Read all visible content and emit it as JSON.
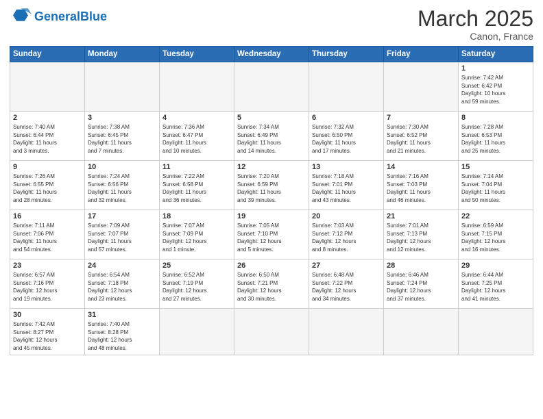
{
  "header": {
    "logo_general": "General",
    "logo_blue": "Blue",
    "month_title": "March 2025",
    "location": "Canon, France"
  },
  "weekdays": [
    "Sunday",
    "Monday",
    "Tuesday",
    "Wednesday",
    "Thursday",
    "Friday",
    "Saturday"
  ],
  "weeks": [
    [
      {
        "day": "",
        "info": ""
      },
      {
        "day": "",
        "info": ""
      },
      {
        "day": "",
        "info": ""
      },
      {
        "day": "",
        "info": ""
      },
      {
        "day": "",
        "info": ""
      },
      {
        "day": "",
        "info": ""
      },
      {
        "day": "1",
        "info": "Sunrise: 7:42 AM\nSunset: 6:42 PM\nDaylight: 10 hours\nand 59 minutes."
      }
    ],
    [
      {
        "day": "2",
        "info": "Sunrise: 7:40 AM\nSunset: 6:44 PM\nDaylight: 11 hours\nand 3 minutes."
      },
      {
        "day": "3",
        "info": "Sunrise: 7:38 AM\nSunset: 6:45 PM\nDaylight: 11 hours\nand 7 minutes."
      },
      {
        "day": "4",
        "info": "Sunrise: 7:36 AM\nSunset: 6:47 PM\nDaylight: 11 hours\nand 10 minutes."
      },
      {
        "day": "5",
        "info": "Sunrise: 7:34 AM\nSunset: 6:49 PM\nDaylight: 11 hours\nand 14 minutes."
      },
      {
        "day": "6",
        "info": "Sunrise: 7:32 AM\nSunset: 6:50 PM\nDaylight: 11 hours\nand 17 minutes."
      },
      {
        "day": "7",
        "info": "Sunrise: 7:30 AM\nSunset: 6:52 PM\nDaylight: 11 hours\nand 21 minutes."
      },
      {
        "day": "8",
        "info": "Sunrise: 7:28 AM\nSunset: 6:53 PM\nDaylight: 11 hours\nand 25 minutes."
      }
    ],
    [
      {
        "day": "9",
        "info": "Sunrise: 7:26 AM\nSunset: 6:55 PM\nDaylight: 11 hours\nand 28 minutes."
      },
      {
        "day": "10",
        "info": "Sunrise: 7:24 AM\nSunset: 6:56 PM\nDaylight: 11 hours\nand 32 minutes."
      },
      {
        "day": "11",
        "info": "Sunrise: 7:22 AM\nSunset: 6:58 PM\nDaylight: 11 hours\nand 36 minutes."
      },
      {
        "day": "12",
        "info": "Sunrise: 7:20 AM\nSunset: 6:59 PM\nDaylight: 11 hours\nand 39 minutes."
      },
      {
        "day": "13",
        "info": "Sunrise: 7:18 AM\nSunset: 7:01 PM\nDaylight: 11 hours\nand 43 minutes."
      },
      {
        "day": "14",
        "info": "Sunrise: 7:16 AM\nSunset: 7:03 PM\nDaylight: 11 hours\nand 46 minutes."
      },
      {
        "day": "15",
        "info": "Sunrise: 7:14 AM\nSunset: 7:04 PM\nDaylight: 11 hours\nand 50 minutes."
      }
    ],
    [
      {
        "day": "16",
        "info": "Sunrise: 7:11 AM\nSunset: 7:06 PM\nDaylight: 11 hours\nand 54 minutes."
      },
      {
        "day": "17",
        "info": "Sunrise: 7:09 AM\nSunset: 7:07 PM\nDaylight: 11 hours\nand 57 minutes."
      },
      {
        "day": "18",
        "info": "Sunrise: 7:07 AM\nSunset: 7:09 PM\nDaylight: 12 hours\nand 1 minute."
      },
      {
        "day": "19",
        "info": "Sunrise: 7:05 AM\nSunset: 7:10 PM\nDaylight: 12 hours\nand 5 minutes."
      },
      {
        "day": "20",
        "info": "Sunrise: 7:03 AM\nSunset: 7:12 PM\nDaylight: 12 hours\nand 8 minutes."
      },
      {
        "day": "21",
        "info": "Sunrise: 7:01 AM\nSunset: 7:13 PM\nDaylight: 12 hours\nand 12 minutes."
      },
      {
        "day": "22",
        "info": "Sunrise: 6:59 AM\nSunset: 7:15 PM\nDaylight: 12 hours\nand 16 minutes."
      }
    ],
    [
      {
        "day": "23",
        "info": "Sunrise: 6:57 AM\nSunset: 7:16 PM\nDaylight: 12 hours\nand 19 minutes."
      },
      {
        "day": "24",
        "info": "Sunrise: 6:54 AM\nSunset: 7:18 PM\nDaylight: 12 hours\nand 23 minutes."
      },
      {
        "day": "25",
        "info": "Sunrise: 6:52 AM\nSunset: 7:19 PM\nDaylight: 12 hours\nand 27 minutes."
      },
      {
        "day": "26",
        "info": "Sunrise: 6:50 AM\nSunset: 7:21 PM\nDaylight: 12 hours\nand 30 minutes."
      },
      {
        "day": "27",
        "info": "Sunrise: 6:48 AM\nSunset: 7:22 PM\nDaylight: 12 hours\nand 34 minutes."
      },
      {
        "day": "28",
        "info": "Sunrise: 6:46 AM\nSunset: 7:24 PM\nDaylight: 12 hours\nand 37 minutes."
      },
      {
        "day": "29",
        "info": "Sunrise: 6:44 AM\nSunset: 7:25 PM\nDaylight: 12 hours\nand 41 minutes."
      }
    ],
    [
      {
        "day": "30",
        "info": "Sunrise: 7:42 AM\nSunset: 8:27 PM\nDaylight: 12 hours\nand 45 minutes."
      },
      {
        "day": "31",
        "info": "Sunrise: 7:40 AM\nSunset: 8:28 PM\nDaylight: 12 hours\nand 48 minutes."
      },
      {
        "day": "",
        "info": ""
      },
      {
        "day": "",
        "info": ""
      },
      {
        "day": "",
        "info": ""
      },
      {
        "day": "",
        "info": ""
      },
      {
        "day": "",
        "info": ""
      }
    ]
  ]
}
